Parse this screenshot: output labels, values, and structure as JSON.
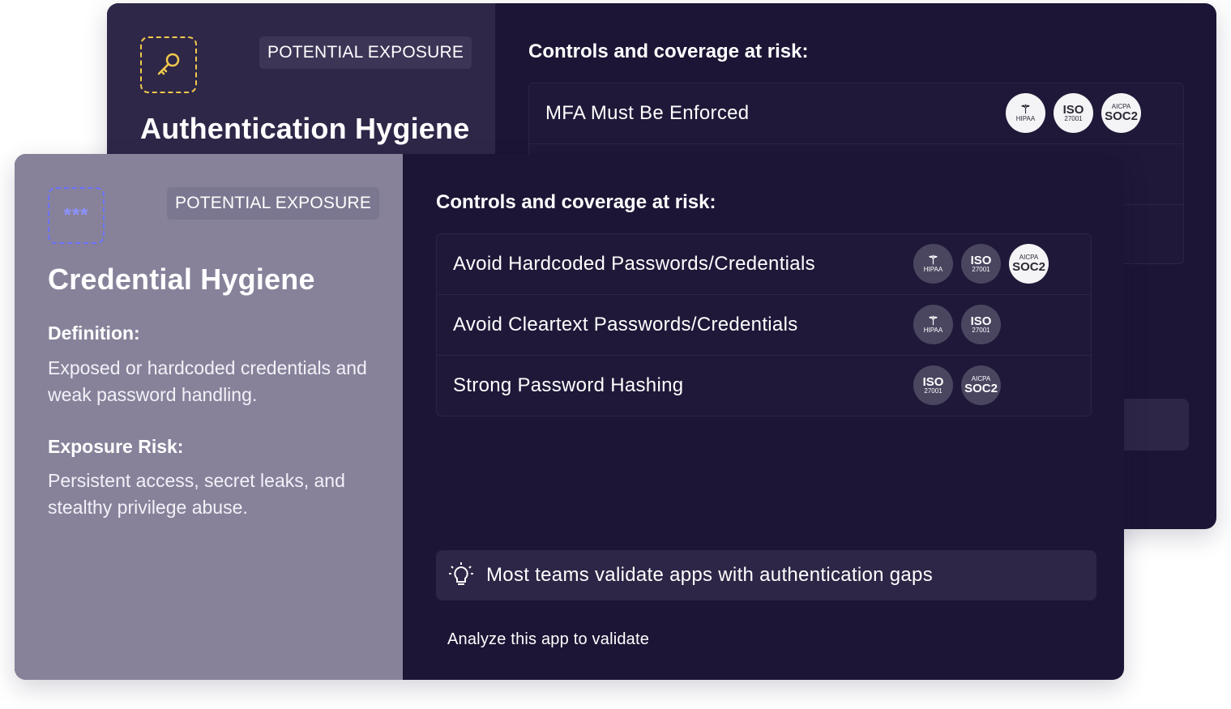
{
  "back_card": {
    "badge": "POTENTIAL EXPOSURE",
    "title": "Authentication Hygiene",
    "section_title": "Controls and coverage at risk:",
    "controls": [
      {
        "label": "MFA Must Be Enforced",
        "frameworks": [
          "HIPAA",
          "ISO 27001",
          "AICPA SOC2"
        ]
      }
    ],
    "icon": "key-icon"
  },
  "front_card": {
    "badge": "POTENTIAL EXPOSURE",
    "title": "Credential Hygiene",
    "definition_label": "Definition:",
    "definition_text": "Exposed or hardcoded credentials and weak password handling.",
    "risk_label": "Exposure Risk:",
    "risk_text": "Persistent access, secret leaks, and stealthy privilege abuse.",
    "section_title": "Controls and coverage at risk:",
    "controls": [
      {
        "label": "Avoid Hardcoded Passwords/Credentials",
        "frameworks": [
          "HIPAA",
          "ISO 27001",
          "AICPA SOC2"
        ]
      },
      {
        "label": "Avoid Cleartext Passwords/Credentials",
        "frameworks": [
          "HIPAA",
          "ISO 27001"
        ]
      },
      {
        "label": "Strong Password Hashing",
        "frameworks": [
          "ISO 27001",
          "AICPA SOC2"
        ]
      }
    ],
    "tip_text": "Most teams validate apps with authentication gaps",
    "cta_text": "Analyze this app to validate",
    "icon": "password-asterisk-icon"
  },
  "logos": {
    "hipaa": {
      "big": "",
      "small": "HIPAA"
    },
    "iso": {
      "big": "ISO",
      "small": "27001"
    },
    "soc2": {
      "top": "AICPA",
      "big": "SOC2"
    }
  },
  "colors": {
    "card_bg": "#1c1535",
    "front_left_bg": "#87829a",
    "back_left_bg": "#2f2748",
    "key_icon": "#f2c94c",
    "asterisk_icon": "#6b72ff"
  }
}
